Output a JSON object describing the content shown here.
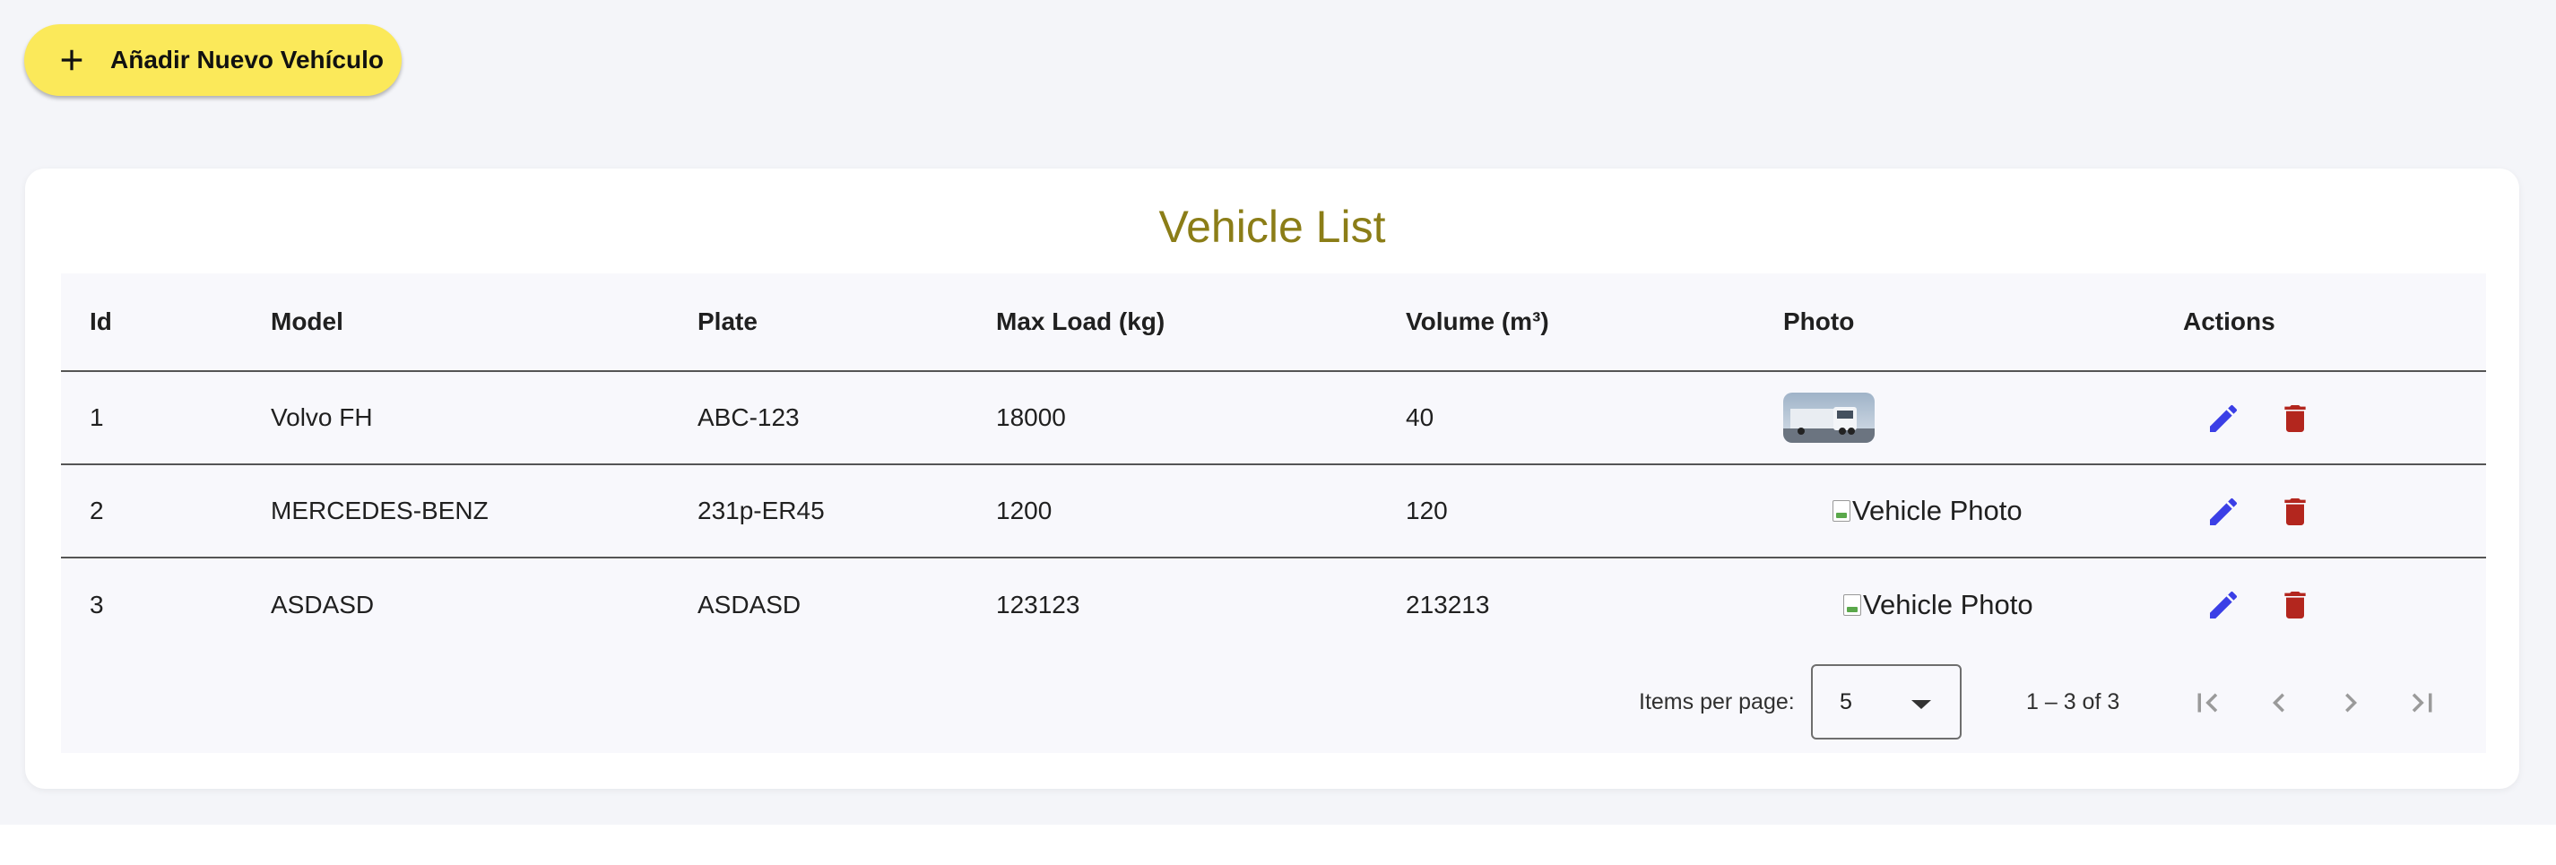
{
  "toolbar": {
    "add_vehicle_label": "Añadir Nuevo Vehículo",
    "add_icon": "plus-icon"
  },
  "vehicle_list": {
    "title": "Vehicle List",
    "columns": [
      "Id",
      "Model",
      "Plate",
      "Max Load (kg)",
      "Volume (m³)",
      "Photo",
      "Actions"
    ],
    "rows": [
      {
        "id": "1",
        "model": "Volvo FH",
        "plate": "ABC-123",
        "max_load": "18000",
        "volume": "40",
        "photo_alt": "Vehicle Photo",
        "photo_loaded": true
      },
      {
        "id": "2",
        "model": "MERCEDES-BENZ",
        "plate": "231p-ER45",
        "max_load": "1200",
        "volume": "120",
        "photo_alt": "Vehicle Photo",
        "photo_loaded": false
      },
      {
        "id": "3",
        "model": "ASDASD",
        "plate": "ASDASD",
        "max_load": "123123",
        "volume": "213213",
        "photo_alt": "Vehicle Photo",
        "photo_loaded": false
      }
    ],
    "action_icons": {
      "edit": "pencil-icon",
      "delete": "trash-icon"
    }
  },
  "paginator": {
    "items_per_page_label": "Items per page:",
    "items_per_page_value": "5",
    "range_label": "1 – 3 of 3",
    "nav_icons": [
      "first-page-icon",
      "previous-page-icon",
      "next-page-icon",
      "last-page-icon"
    ]
  },
  "colors": {
    "accent_yellow": "#fbe95a",
    "title_olive": "#8b7d17",
    "edit_blue": "#3b3fe6",
    "delete_red": "#b3261e",
    "page_bg": "#f4f5f9"
  }
}
